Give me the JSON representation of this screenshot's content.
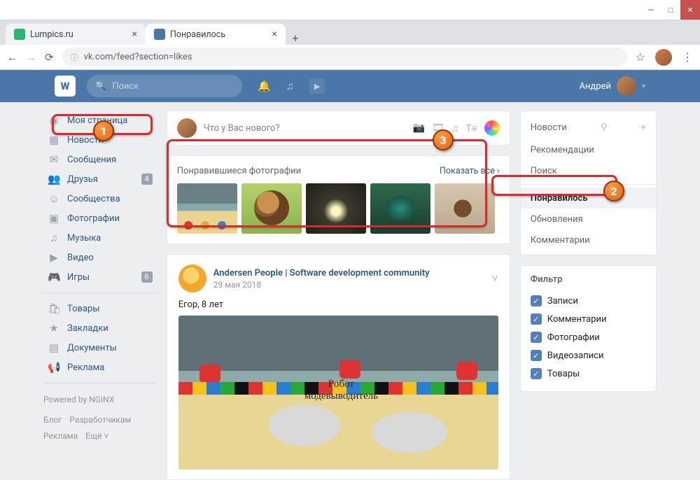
{
  "window": {
    "min": "—",
    "max": "□",
    "close": "✕"
  },
  "tabs": [
    {
      "title": "Lumpics.ru"
    },
    {
      "title": "Понравилось"
    }
  ],
  "addressbar": {
    "url": "vk.com/feed?section=likes",
    "star": "☆"
  },
  "vk_header": {
    "logo": "W",
    "search_placeholder": "Поиск",
    "username": "Андрей"
  },
  "leftnav": {
    "items": [
      {
        "icon": "◉",
        "label": "Моя страница"
      },
      {
        "icon": "▦",
        "label": "Новости"
      },
      {
        "icon": "✉",
        "label": "Сообщения"
      },
      {
        "icon": "👥",
        "label": "Друзья",
        "badge": "4"
      },
      {
        "icon": "☺",
        "label": "Сообщества"
      },
      {
        "icon": "▣",
        "label": "Фотографии"
      },
      {
        "icon": "♫",
        "label": "Музыка"
      },
      {
        "icon": "▶",
        "label": "Видео"
      },
      {
        "icon": "🎮",
        "label": "Игры",
        "badge": "6"
      }
    ],
    "items2": [
      {
        "icon": "🛍",
        "label": "Товары"
      },
      {
        "icon": "★",
        "label": "Закладки"
      },
      {
        "icon": "▤",
        "label": "Документы"
      },
      {
        "icon": "📢",
        "label": "Реклама"
      }
    ],
    "powered": "Powered by NGINX",
    "footer": [
      "Блог",
      "Разработчикам",
      "Реклама",
      "Ещё ˅"
    ]
  },
  "composer": {
    "placeholder": "Что у Вас нового?"
  },
  "liked": {
    "heading": "Понравившиеся фотографии",
    "showall": "Показать все",
    "chev": "›"
  },
  "post": {
    "author": "Andersen People | Software development community",
    "date": "29 мая 2018",
    "text": "Егор, 8 лет"
  },
  "rightnav": {
    "head": "Новости",
    "items": [
      "Рекомендации",
      "Поиск"
    ],
    "active": "Понравилось",
    "items2": [
      "Обновления",
      "Комментарии"
    ]
  },
  "filter": {
    "title": "Фильтр",
    "items": [
      "Записи",
      "Комментарии",
      "Фотографии",
      "Видеозаписи",
      "Товары"
    ]
  },
  "callouts": {
    "n1": "1",
    "n2": "2",
    "n3": "3"
  }
}
